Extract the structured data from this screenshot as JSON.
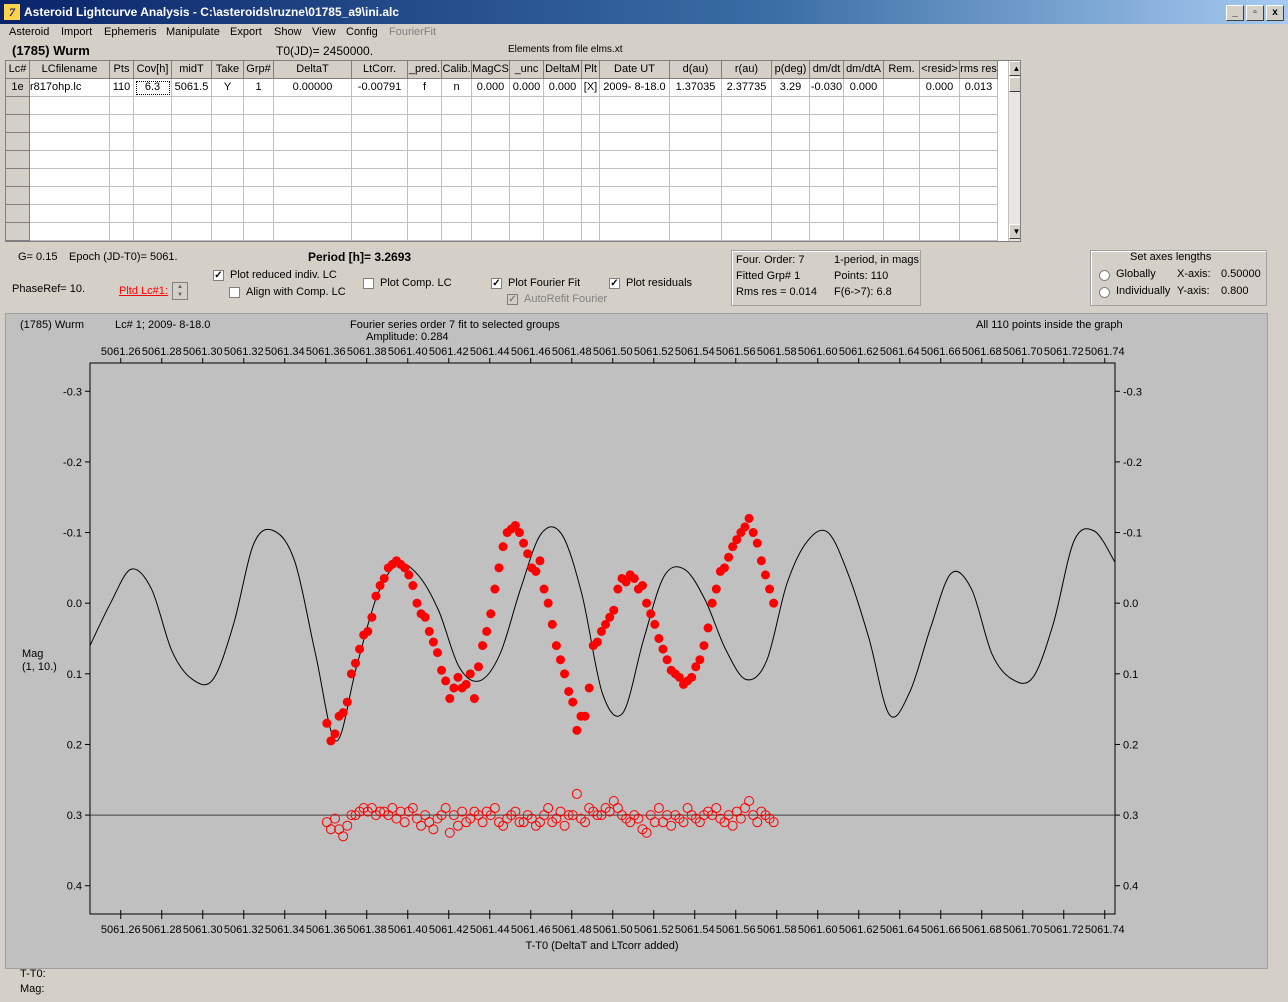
{
  "window": {
    "title": "Asteroid Lightcurve Analysis - C:\\asteroids\\ruzne\\01785_a9\\ini.alc",
    "app_icon": "7",
    "minimize": "_",
    "restore": "▫",
    "close": "x"
  },
  "menu": [
    "Asteroid",
    "Import",
    "Ephemeris",
    "Manipulate",
    "Export",
    "Show",
    "View",
    "Config",
    "FourierFit"
  ],
  "header": {
    "asteroid": "(1785) Wurm",
    "t0": "T0(JD)= 2450000.",
    "elements": "Elements from file elms.xt"
  },
  "table": {
    "columns": [
      "Lc#",
      "LCfilename",
      "Pts",
      "Cov[h]",
      "midT",
      "Take",
      "Grp#",
      "DeltaT",
      "LtCorr.",
      "_pred.",
      "Calib.",
      "MagCS",
      "_unc",
      "DeltaM",
      "Plt",
      "Date UT",
      "d(au)",
      "r(au)",
      "p(deg)",
      "dm/dt",
      "dm/dtA",
      "Rem.",
      "<resid>",
      "rms res"
    ],
    "rows": [
      [
        "1e",
        "r817ohp.lc",
        "110",
        "6.3",
        "5061.5",
        "Y",
        "1",
        "0.00000",
        "-0.00791",
        "f",
        "n",
        "0.000",
        "0.000",
        "0.000",
        "[X]",
        "2009- 8-18.0",
        "1.37035",
        "2.37735",
        "3.29",
        "-0.030",
        "0.000",
        "",
        "0.000",
        "0.013"
      ]
    ]
  },
  "info": {
    "g": "G= 0.15",
    "epoch": "Epoch (JD-T0)= 5061.",
    "period": "Period [h]= 3.2693",
    "phaseref": "PhaseRef= 10.",
    "pltd_lc": "Pltd Lc#1:",
    "plot_reduced": "Plot reduced indiv. LC",
    "align_comp": "Align with Comp. LC",
    "plot_comp": "Plot Comp. LC",
    "plot_fourier": "Plot Fourier Fit",
    "autorefit": "AutoRefit Fourier",
    "plot_residuals": "Plot residuals"
  },
  "fourier_box": {
    "order": "Four. Order:  7",
    "mode": "1-period, in mags",
    "fitted": "Fitted Grp# 1",
    "points": "Points: 110",
    "rms": "Rms res     = 0.014",
    "f": "F(6->7):    6.8"
  },
  "axes_box": {
    "title": "Set axes lengths",
    "globally": "Globally",
    "individually": "Individually",
    "xaxis_label": "X-axis:",
    "xaxis_value": "0.50000",
    "yaxis_label": "Y-axis:",
    "yaxis_value": "0.800"
  },
  "plot_header": {
    "object": "(1785) Wurm",
    "lc": "Lc# 1; 2009- 8-18.0",
    "fourier": "Fourier series order 7 fit to selected groups",
    "amplitude": "Amplitude: 0.284",
    "points_inside": "All 110 points inside the graph"
  },
  "chart_data": {
    "type": "scatter",
    "xlabel": "T-T0 (DeltaT and LTcorr added)",
    "ylabel": "Mag\n(1, 10.)",
    "xlim": [
      5061.245,
      5061.745
    ],
    "ylim": [
      -0.34,
      0.44
    ],
    "y_inverted": true,
    "xticks": [
      5061.26,
      5061.28,
      5061.3,
      5061.32,
      5061.34,
      5061.36,
      5061.38,
      5061.4,
      5061.42,
      5061.44,
      5061.46,
      5061.48,
      5061.5,
      5061.52,
      5061.54,
      5061.56,
      5061.58,
      5061.6,
      5061.62,
      5061.64,
      5061.66,
      5061.68,
      5061.7,
      5061.72,
      5061.74
    ],
    "xtick_labels": [
      "5061.26",
      "5061.28",
      "5061.30",
      "5061.32",
      "5061.34",
      "5061.36",
      "5061.38",
      "5061.40",
      "5061.42",
      "5061.44",
      "5061.46",
      "5061.48",
      "5061.50",
      "5061.52",
      "5061.54",
      "5061.56",
      "5061.58",
      "5061.60",
      "5061.62",
      "5061.64",
      "5061.66",
      "5061.68",
      "5061.70",
      "5061.72",
      "5061.74"
    ],
    "yticks": [
      -0.3,
      -0.2,
      -0.1,
      0.0,
      0.1,
      0.2,
      0.3,
      0.4
    ],
    "ytick_labels": [
      "-0.3",
      "-0.2",
      "-0.1",
      "0.0",
      "0.1",
      "0.2",
      "0.3",
      "0.4"
    ],
    "residual_baseline": 0.3,
    "marker_color": "#ff0000",
    "fit_color": "#000000",
    "background": "#c0c0c0",
    "fourier_fit": {
      "x": [
        5061.245,
        5061.255,
        5061.265,
        5061.275,
        5061.285,
        5061.295,
        5061.305,
        5061.315,
        5061.325,
        5061.335,
        5061.345,
        5061.355,
        5061.365,
        5061.375,
        5061.385,
        5061.395,
        5061.405,
        5061.415,
        5061.425,
        5061.435,
        5061.445,
        5061.455,
        5061.465,
        5061.475,
        5061.485,
        5061.495,
        5061.505,
        5061.515,
        5061.525,
        5061.535,
        5061.545,
        5061.555,
        5061.565,
        5061.575,
        5061.585,
        5061.595,
        5061.605,
        5061.615,
        5061.625,
        5061.635,
        5061.645,
        5061.655,
        5061.665,
        5061.675,
        5061.685,
        5061.695,
        5061.705,
        5061.715,
        5061.725,
        5061.735,
        5061.745
      ],
      "y": [
        0.06,
        0.0,
        -0.048,
        -0.02,
        0.068,
        0.108,
        0.108,
        0.03,
        -0.085,
        -0.102,
        -0.058,
        0.072,
        0.195,
        0.09,
        -0.01,
        -0.055,
        -0.04,
        0.01,
        0.09,
        0.11,
        0.072,
        -0.02,
        -0.098,
        -0.098,
        -0.012,
        0.128,
        0.155,
        0.052,
        -0.038,
        -0.048,
        -0.005,
        0.065,
        0.108,
        0.082,
        -0.028,
        -0.088,
        -0.1,
        -0.04,
        0.05,
        0.158,
        0.125,
        0.035,
        -0.042,
        -0.02,
        0.072,
        0.108,
        0.105,
        0.028,
        -0.088,
        -0.102,
        -0.058
      ]
    },
    "series": [
      {
        "name": "observations",
        "x": [
          5061.3605,
          5061.3625,
          5061.3645,
          5061.3665,
          5061.3685,
          5061.3705,
          5061.3725,
          5061.3745,
          5061.3765,
          5061.3785,
          5061.3805,
          5061.3825,
          5061.3845,
          5061.3865,
          5061.3885,
          5061.3905,
          5061.3925,
          5061.3945,
          5061.3965,
          5061.3985,
          5061.4005,
          5061.4025,
          5061.4045,
          5061.4065,
          5061.4085,
          5061.4105,
          5061.4125,
          5061.4145,
          5061.4165,
          5061.4185,
          5061.4205,
          5061.4225,
          5061.4245,
          5061.4265,
          5061.4285,
          5061.4305,
          5061.4325,
          5061.4345,
          5061.4365,
          5061.4385,
          5061.4405,
          5061.4425,
          5061.4445,
          5061.4465,
          5061.4485,
          5061.4505,
          5061.4525,
          5061.4545,
          5061.4565,
          5061.4585,
          5061.4605,
          5061.4625,
          5061.4645,
          5061.4665,
          5061.4685,
          5061.4705,
          5061.4725,
          5061.4745,
          5061.4765,
          5061.4785,
          5061.4805,
          5061.4825,
          5061.4845,
          5061.4865,
          5061.4885,
          5061.4905,
          5061.4925,
          5061.4945,
          5061.4965,
          5061.4985,
          5061.5005,
          5061.5025,
          5061.5045,
          5061.5065,
          5061.5085,
          5061.5105,
          5061.5125,
          5061.5145,
          5061.5165,
          5061.5185,
          5061.5205,
          5061.5225,
          5061.5245,
          5061.5265,
          5061.5285,
          5061.5305,
          5061.5325,
          5061.5345,
          5061.5365,
          5061.5385,
          5061.5405,
          5061.5425,
          5061.5445,
          5061.5465,
          5061.5485,
          5061.5505,
          5061.5525,
          5061.5545,
          5061.5565,
          5061.5585,
          5061.5605,
          5061.5625,
          5061.5645,
          5061.5665,
          5061.5685,
          5061.5705,
          5061.5725,
          5061.5745,
          5061.5765,
          5061.5785
        ],
        "y": [
          0.17,
          0.195,
          0.185,
          0.16,
          0.155,
          0.14,
          0.1,
          0.085,
          0.065,
          0.045,
          0.04,
          0.02,
          -0.01,
          -0.025,
          -0.035,
          -0.05,
          -0.055,
          -0.06,
          -0.055,
          -0.05,
          -0.04,
          -0.025,
          0.0,
          0.015,
          0.02,
          0.04,
          0.055,
          0.07,
          0.095,
          0.11,
          0.135,
          0.12,
          0.105,
          0.12,
          0.115,
          0.1,
          0.135,
          0.09,
          0.06,
          0.04,
          0.015,
          -0.02,
          -0.05,
          -0.08,
          -0.1,
          -0.105,
          -0.11,
          -0.1,
          -0.085,
          -0.07,
          -0.05,
          -0.045,
          -0.06,
          -0.02,
          0.0,
          0.03,
          0.06,
          0.08,
          0.1,
          0.125,
          0.14,
          0.18,
          0.16,
          0.16,
          0.12,
          0.06,
          0.055,
          0.04,
          0.03,
          0.02,
          0.01,
          -0.02,
          -0.035,
          -0.03,
          -0.04,
          -0.035,
          -0.02,
          -0.025,
          0.0,
          0.015,
          0.03,
          0.05,
          0.065,
          0.08,
          0.095,
          0.1,
          0.105,
          0.115,
          0.11,
          0.105,
          0.09,
          0.08,
          0.06,
          0.035,
          0.0,
          -0.02,
          -0.045,
          -0.05,
          -0.065,
          -0.08,
          -0.09,
          -0.1,
          -0.108,
          -0.12,
          -0.1,
          -0.085,
          -0.06,
          -0.04,
          -0.02,
          0.0
        ]
      },
      {
        "name": "residuals",
        "x": [
          5061.3605,
          5061.3625,
          5061.3645,
          5061.3665,
          5061.3685,
          5061.3705,
          5061.3725,
          5061.3745,
          5061.3765,
          5061.3785,
          5061.3805,
          5061.3825,
          5061.3845,
          5061.3865,
          5061.3885,
          5061.3905,
          5061.3925,
          5061.3945,
          5061.3965,
          5061.3985,
          5061.4005,
          5061.4025,
          5061.4045,
          5061.4065,
          5061.4085,
          5061.4105,
          5061.4125,
          5061.4145,
          5061.4165,
          5061.4185,
          5061.4205,
          5061.4225,
          5061.4245,
          5061.4265,
          5061.4285,
          5061.4305,
          5061.4325,
          5061.4345,
          5061.4365,
          5061.4385,
          5061.4405,
          5061.4425,
          5061.4445,
          5061.4465,
          5061.4485,
          5061.4505,
          5061.4525,
          5061.4545,
          5061.4565,
          5061.4585,
          5061.4605,
          5061.4625,
          5061.4645,
          5061.4665,
          5061.4685,
          5061.4705,
          5061.4725,
          5061.4745,
          5061.4765,
          5061.4785,
          5061.4805,
          5061.4825,
          5061.4845,
          5061.4865,
          5061.4885,
          5061.4905,
          5061.4925,
          5061.4945,
          5061.4965,
          5061.4985,
          5061.5005,
          5061.5025,
          5061.5045,
          5061.5065,
          5061.5085,
          5061.5105,
          5061.5125,
          5061.5145,
          5061.5165,
          5061.5185,
          5061.5205,
          5061.5225,
          5061.5245,
          5061.5265,
          5061.5285,
          5061.5305,
          5061.5325,
          5061.5345,
          5061.5365,
          5061.5385,
          5061.5405,
          5061.5425,
          5061.5445,
          5061.5465,
          5061.5485,
          5061.5505,
          5061.5525,
          5061.5545,
          5061.5565,
          5061.5585,
          5061.5605,
          5061.5625,
          5061.5645,
          5061.5665,
          5061.5685,
          5061.5705,
          5061.5725,
          5061.5745,
          5061.5765,
          5061.5785
        ],
        "y": [
          0.31,
          0.32,
          0.305,
          0.32,
          0.33,
          0.315,
          0.3,
          0.3,
          0.295,
          0.29,
          0.295,
          0.29,
          0.3,
          0.295,
          0.295,
          0.3,
          0.29,
          0.305,
          0.295,
          0.31,
          0.295,
          0.29,
          0.305,
          0.315,
          0.3,
          0.31,
          0.32,
          0.305,
          0.3,
          0.29,
          0.325,
          0.3,
          0.315,
          0.295,
          0.31,
          0.305,
          0.295,
          0.3,
          0.31,
          0.295,
          0.3,
          0.29,
          0.31,
          0.315,
          0.305,
          0.3,
          0.295,
          0.31,
          0.31,
          0.3,
          0.305,
          0.315,
          0.31,
          0.3,
          0.29,
          0.31,
          0.305,
          0.295,
          0.315,
          0.3,
          0.3,
          0.27,
          0.305,
          0.31,
          0.29,
          0.295,
          0.3,
          0.3,
          0.29,
          0.295,
          0.28,
          0.29,
          0.3,
          0.305,
          0.31,
          0.3,
          0.305,
          0.32,
          0.325,
          0.3,
          0.31,
          0.29,
          0.31,
          0.3,
          0.315,
          0.3,
          0.305,
          0.31,
          0.29,
          0.3,
          0.305,
          0.31,
          0.3,
          0.295,
          0.3,
          0.29,
          0.305,
          0.31,
          0.3,
          0.315,
          0.295,
          0.305,
          0.29,
          0.28,
          0.3,
          0.31,
          0.295,
          0.3,
          0.305,
          0.31
        ]
      }
    ]
  }
}
